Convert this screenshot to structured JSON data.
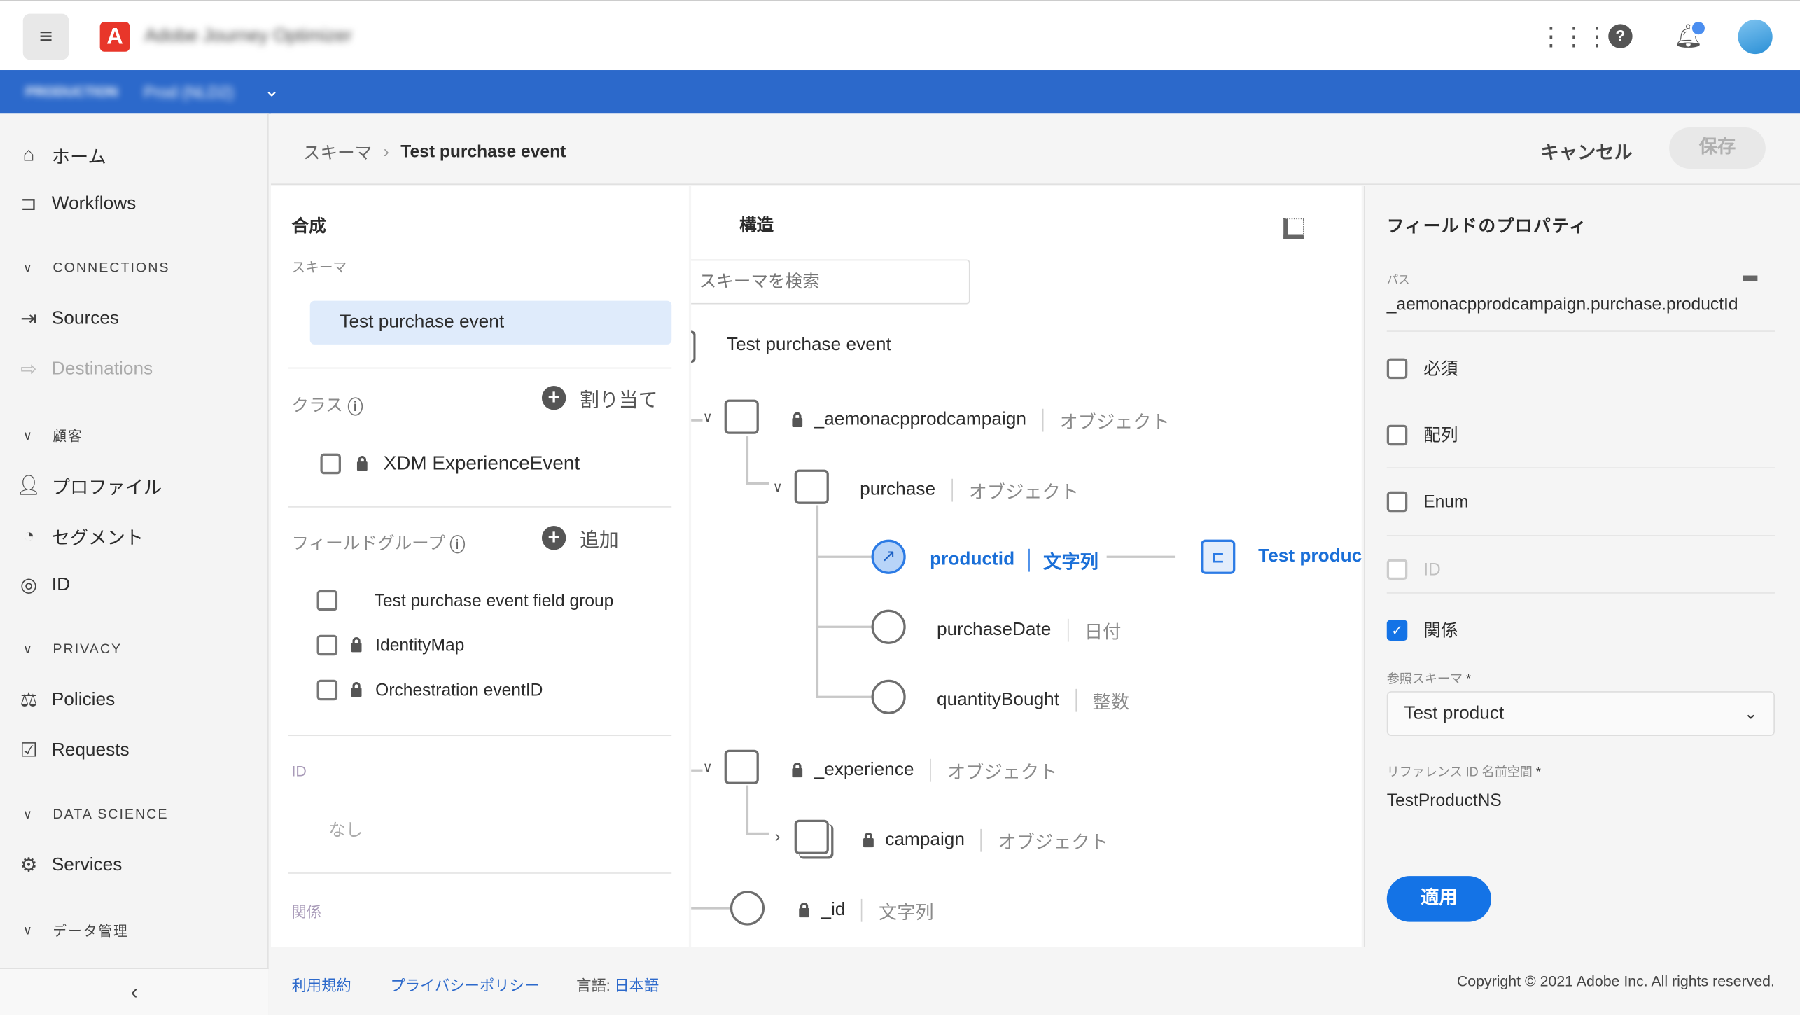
{
  "header": {
    "app_name": "Adobe Journey Optimizer",
    "org_label": "PRODUCTION",
    "sandbox": "Prod (NLD2)"
  },
  "sidebar": {
    "items": [
      {
        "label": "ホーム",
        "icon": "home-icon"
      },
      {
        "label": "Workflows",
        "icon": "workflows-icon"
      },
      {
        "label": "Sources",
        "icon": "sources-icon"
      },
      {
        "label": "Destinations",
        "icon": "destinations-icon"
      },
      {
        "label": "プロファイル",
        "icon": "profile-icon"
      },
      {
        "label": "セグメント",
        "icon": "segment-icon"
      },
      {
        "label": "ID",
        "icon": "fingerprint-icon"
      },
      {
        "label": "Policies",
        "icon": "gavel-icon"
      },
      {
        "label": "Requests",
        "icon": "checklist-icon"
      },
      {
        "label": "Services",
        "icon": "services-icon"
      }
    ],
    "sections": [
      "CONNECTIONS",
      "顧客",
      "PRIVACY",
      "DATA SCIENCE",
      "データ管理"
    ]
  },
  "breadcrumb": {
    "root": "スキーマ",
    "current": "Test purchase event"
  },
  "actions": {
    "cancel": "キャンセル",
    "save": "保存"
  },
  "composition": {
    "title": "合成",
    "schema_label": "スキーマ",
    "schema_name": "Test purchase event",
    "class_label": "クラス",
    "assign": "割り当て",
    "class_item": "XDM ExperienceEvent",
    "field_groups_label": "フィールドグループ",
    "add": "追加",
    "field_groups": [
      "Test purchase event field group",
      "IdentityMap",
      "Orchestration eventID"
    ],
    "id_label": "ID",
    "id_value": "なし",
    "relations_label": "関係"
  },
  "structure": {
    "title": "構造",
    "search_placeholder": "スキーマを検索",
    "root": "Test purchase event",
    "nodes": [
      {
        "name": "_aemonacpprodcampaign",
        "type": "オブジェクト"
      },
      {
        "name": "purchase",
        "type": "オブジェクト"
      },
      {
        "name": "productid",
        "type": "文字列",
        "ref": "Test product"
      },
      {
        "name": "purchaseDate",
        "type": "日付"
      },
      {
        "name": "quantityBought",
        "type": "整数"
      },
      {
        "name": "_experience",
        "type": "オブジェクト"
      },
      {
        "name": "campaign",
        "type": "オブジェクト"
      },
      {
        "name": "_id",
        "type": "文字列"
      }
    ]
  },
  "properties": {
    "title": "フィールドのプロパティ",
    "path_label": "パス",
    "path": "_aemonacpprodcampaign.purchase.productId",
    "required": "必須",
    "array": "配列",
    "enum": "Enum",
    "identity": "ID",
    "relationship": "関係",
    "ref_schema_label": "参照スキーマ",
    "ref_schema": "Test product",
    "ref_ns_label": "リファレンス ID 名前空間",
    "ref_ns": "TestProductNS",
    "apply": "適用",
    "required_mark": "*"
  },
  "footer": {
    "terms": "利用規約",
    "privacy": "プライバシーポリシー",
    "language_label": "言語:",
    "language": "日本語",
    "copyright": "Copyright © 2021 Adobe Inc. All rights reserved."
  }
}
